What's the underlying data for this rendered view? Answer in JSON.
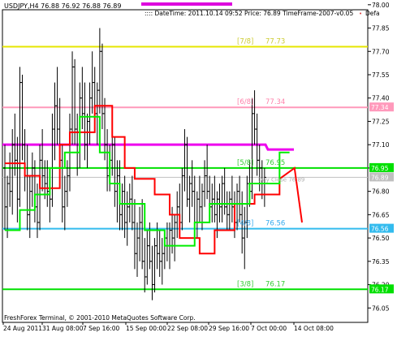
{
  "chart_data": {
    "type": "candlestick",
    "header": {
      "symbol_info": "USDJPY,H4  76.88 76.92 76.88 76.89",
      "info": ":::: DateTime: 2011.10.14 09:52    Price: 76.89    TimeFrame-2007-v0.05",
      "extra": "Defa"
    },
    "footer": "FreshForex Terminal, © 2001-2010 MetaQuotes Software Corp.",
    "ylim": [
      76.02,
      78.02
    ],
    "y_ticks": [
      "78.00",
      "77.85",
      "77.70",
      "77.55",
      "77.40",
      "77.25",
      "77.10",
      "76.95",
      "76.80",
      "76.65",
      "76.50",
      "76.35",
      "76.20",
      "76.05"
    ],
    "x_ticks": [
      "24 Aug 2011",
      "31 Aug 08:00",
      "7 Sep 16:00",
      "15 Sep 00:00",
      "22 Sep 08:00",
      "29 Sep 16:00",
      "7 Oct 00:00",
      "14 Oct 08:00"
    ],
    "bar_count": 120,
    "levels": [
      {
        "name": "[7/8]",
        "value_label": "77.73",
        "price": 77.73,
        "color": "#e6e600",
        "label_color": "#cccc33",
        "tag": ""
      },
      {
        "name": "[6/8]",
        "value_label": "77.34",
        "price": 77.34,
        "color": "#ff99bb",
        "label_color": "#ff80aa",
        "tag": "77.34"
      },
      {
        "name": "[5/8]",
        "value_label": "76.95",
        "price": 76.95,
        "color": "#00e000",
        "label_color": "#33cc33",
        "tag": "76.95"
      },
      {
        "name": "[4/8]",
        "value_label": "76.56",
        "price": 76.56,
        "color": "#33bbee",
        "label_color": "#33aaee",
        "tag": "76.56"
      },
      {
        "name": "[3/8]",
        "value_label": "76.17",
        "price": 76.17,
        "color": "#00e000",
        "label_color": "#33cc33",
        "tag": "76.17"
      }
    ],
    "current_price": {
      "value": 76.89,
      "tag": "76.89"
    },
    "magenta_line": {
      "price": 77.1,
      "color": "#ee00ee"
    },
    "daily_label": "Day Close 76.89",
    "colors": {
      "bars": "#000000",
      "red_line": "#ff0000",
      "green_line": "#00ee00",
      "grey": "#c0c0c0"
    },
    "bars": [
      [
        76.95,
        77.1,
        76.55,
        76.7
      ],
      [
        76.7,
        76.9,
        76.5,
        76.85
      ],
      [
        76.85,
        77.05,
        76.7,
        76.8
      ],
      [
        76.8,
        77.2,
        76.65,
        77.1
      ],
      [
        77.1,
        77.3,
        76.9,
        77.0
      ],
      [
        77.0,
        77.15,
        76.6,
        76.75
      ],
      [
        76.75,
        77.6,
        76.7,
        77.5
      ],
      [
        77.5,
        77.55,
        77.0,
        77.1
      ],
      [
        77.1,
        77.2,
        76.8,
        76.9
      ],
      [
        76.9,
        77.1,
        76.55,
        76.65
      ],
      [
        76.65,
        76.9,
        76.5,
        76.8
      ],
      [
        76.8,
        77.05,
        76.7,
        76.95
      ],
      [
        76.95,
        77.0,
        76.6,
        76.7
      ],
      [
        76.7,
        76.85,
        76.5,
        76.6
      ],
      [
        76.6,
        77.1,
        76.55,
        77.0
      ],
      [
        77.0,
        77.2,
        76.8,
        76.9
      ],
      [
        76.9,
        77.0,
        76.75,
        76.85
      ],
      [
        76.85,
        77.0,
        76.7,
        76.8
      ],
      [
        76.8,
        76.9,
        76.6,
        76.75
      ],
      [
        76.75,
        77.3,
        76.7,
        77.2
      ],
      [
        77.2,
        77.5,
        77.0,
        77.35
      ],
      [
        77.35,
        77.6,
        77.1,
        77.2
      ],
      [
        77.2,
        77.4,
        76.9,
        77.0
      ],
      [
        77.0,
        77.1,
        76.6,
        76.7
      ],
      [
        76.7,
        76.9,
        76.55,
        76.8
      ],
      [
        76.8,
        77.0,
        76.7,
        76.9
      ],
      [
        76.9,
        77.3,
        76.8,
        77.2
      ],
      [
        77.2,
        77.7,
        77.1,
        77.6
      ],
      [
        77.6,
        77.65,
        77.1,
        77.2
      ],
      [
        77.2,
        77.3,
        76.9,
        77.05
      ],
      [
        77.05,
        77.5,
        76.95,
        77.4
      ],
      [
        77.4,
        77.6,
        77.2,
        77.3
      ],
      [
        77.3,
        77.5,
        77.0,
        77.1
      ],
      [
        77.1,
        77.3,
        76.95,
        77.25
      ],
      [
        77.25,
        77.5,
        77.1,
        77.4
      ],
      [
        77.4,
        77.7,
        77.3,
        77.5
      ],
      [
        77.5,
        77.6,
        77.2,
        77.3
      ],
      [
        77.3,
        77.5,
        77.1,
        77.45
      ],
      [
        77.45,
        77.85,
        77.3,
        77.7
      ],
      [
        77.7,
        77.75,
        77.2,
        77.3
      ],
      [
        77.3,
        77.4,
        77.0,
        77.1
      ],
      [
        77.1,
        77.2,
        76.8,
        76.9
      ],
      [
        76.9,
        77.1,
        76.8,
        77.0
      ],
      [
        77.0,
        77.2,
        76.9,
        77.1
      ],
      [
        77.1,
        77.15,
        76.7,
        76.8
      ],
      [
        76.8,
        77.0,
        76.6,
        76.9
      ],
      [
        76.9,
        77.0,
        76.55,
        76.65
      ],
      [
        76.65,
        76.85,
        76.55,
        76.8
      ],
      [
        76.8,
        76.9,
        76.5,
        76.6
      ],
      [
        76.6,
        76.8,
        76.45,
        76.7
      ],
      [
        76.7,
        76.85,
        76.6,
        76.75
      ],
      [
        76.75,
        76.9,
        76.55,
        76.6
      ],
      [
        76.6,
        76.75,
        76.3,
        76.4
      ],
      [
        76.4,
        76.6,
        76.25,
        76.5
      ],
      [
        76.5,
        76.7,
        76.35,
        76.6
      ],
      [
        76.6,
        76.75,
        76.3,
        76.35
      ],
      [
        76.35,
        76.5,
        76.15,
        76.25
      ],
      [
        76.25,
        76.55,
        76.2,
        76.45
      ],
      [
        76.45,
        76.6,
        76.3,
        76.35
      ],
      [
        76.35,
        76.45,
        76.1,
        76.2
      ],
      [
        76.2,
        76.5,
        76.15,
        76.45
      ],
      [
        76.45,
        76.6,
        76.3,
        76.4
      ],
      [
        76.4,
        76.55,
        76.25,
        76.35
      ],
      [
        76.35,
        76.5,
        76.2,
        76.4
      ],
      [
        76.4,
        76.55,
        76.3,
        76.5
      ],
      [
        76.5,
        76.6,
        76.35,
        76.45
      ],
      [
        76.45,
        76.6,
        76.3,
        76.55
      ],
      [
        76.55,
        76.7,
        76.4,
        76.5
      ],
      [
        76.5,
        76.65,
        76.35,
        76.6
      ],
      [
        76.6,
        76.8,
        76.5,
        76.7
      ],
      [
        76.7,
        76.85,
        76.55,
        76.6
      ],
      [
        76.6,
        76.95,
        76.55,
        76.9
      ],
      [
        76.9,
        77.2,
        76.8,
        77.1
      ],
      [
        77.1,
        77.15,
        76.7,
        76.75
      ],
      [
        76.75,
        76.9,
        76.6,
        76.85
      ],
      [
        76.85,
        77.0,
        76.7,
        76.8
      ],
      [
        76.8,
        76.9,
        76.55,
        76.6
      ],
      [
        76.6,
        76.8,
        76.5,
        76.75
      ],
      [
        76.75,
        76.9,
        76.6,
        76.7
      ],
      [
        76.7,
        76.85,
        76.55,
        76.8
      ],
      [
        76.8,
        77.0,
        76.7,
        76.9
      ],
      [
        76.9,
        77.1,
        76.75,
        76.8
      ],
      [
        76.8,
        76.9,
        76.6,
        76.7
      ],
      [
        76.7,
        76.85,
        76.6,
        76.75
      ],
      [
        76.75,
        76.9,
        76.6,
        76.65
      ],
      [
        76.65,
        76.8,
        76.5,
        76.75
      ],
      [
        76.75,
        76.85,
        76.6,
        76.7
      ],
      [
        76.7,
        76.9,
        76.6,
        76.85
      ],
      [
        76.85,
        76.95,
        76.65,
        76.7
      ],
      [
        76.7,
        76.8,
        76.55,
        76.65
      ],
      [
        76.65,
        76.8,
        76.55,
        76.75
      ],
      [
        76.75,
        76.9,
        76.6,
        76.7
      ],
      [
        76.7,
        76.8,
        76.5,
        76.6
      ],
      [
        76.6,
        76.85,
        76.55,
        76.8
      ],
      [
        76.8,
        76.9,
        76.6,
        76.65
      ],
      [
        76.65,
        76.8,
        76.4,
        76.5
      ],
      [
        76.5,
        76.7,
        76.3,
        76.6
      ],
      [
        76.6,
        76.9,
        76.5,
        76.85
      ],
      [
        76.85,
        77.0,
        76.7,
        76.8
      ],
      [
        76.8,
        77.4,
        76.75,
        77.3
      ],
      [
        77.3,
        77.45,
        77.1,
        77.2
      ],
      [
        77.2,
        77.3,
        76.9,
        77.0
      ],
      [
        77.0,
        77.1,
        76.8,
        76.95
      ],
      [
        76.95,
        77.0,
        76.75,
        76.85
      ],
      [
        76.85,
        76.95,
        76.7,
        76.89
      ]
    ],
    "red_line": [
      [
        0,
        76.98
      ],
      [
        8,
        76.98
      ],
      [
        8,
        76.9
      ],
      [
        14,
        76.9
      ],
      [
        14,
        76.82
      ],
      [
        22,
        76.82
      ],
      [
        22,
        77.1
      ],
      [
        26,
        77.1
      ],
      [
        26,
        77.18
      ],
      [
        36,
        77.18
      ],
      [
        36,
        77.35
      ],
      [
        43,
        77.35
      ],
      [
        43,
        77.15
      ],
      [
        48,
        77.15
      ],
      [
        48,
        76.95
      ],
      [
        52,
        76.95
      ],
      [
        52,
        76.88
      ],
      [
        60,
        76.88
      ],
      [
        60,
        76.78
      ],
      [
        66,
        76.78
      ],
      [
        66,
        76.65
      ],
      [
        70,
        76.65
      ],
      [
        70,
        76.5
      ],
      [
        78,
        76.5
      ],
      [
        78,
        76.4
      ],
      [
        84,
        76.4
      ],
      [
        84,
        76.55
      ],
      [
        92,
        76.55
      ],
      [
        92,
        76.72
      ],
      [
        100,
        76.72
      ],
      [
        100,
        76.78
      ],
      [
        110,
        76.78
      ],
      [
        110,
        76.88
      ],
      [
        116,
        76.95
      ],
      [
        119,
        76.6
      ]
    ],
    "green_line": [
      [
        0,
        76.55
      ],
      [
        6,
        76.55
      ],
      [
        6,
        76.68
      ],
      [
        12,
        76.68
      ],
      [
        12,
        76.78
      ],
      [
        18,
        76.78
      ],
      [
        18,
        76.95
      ],
      [
        24,
        76.95
      ],
      [
        24,
        77.05
      ],
      [
        30,
        77.05
      ],
      [
        30,
        77.28
      ],
      [
        38,
        77.28
      ],
      [
        38,
        77.05
      ],
      [
        42,
        77.05
      ],
      [
        42,
        76.85
      ],
      [
        46,
        76.85
      ],
      [
        46,
        76.72
      ],
      [
        56,
        76.72
      ],
      [
        56,
        76.55
      ],
      [
        64,
        76.55
      ],
      [
        64,
        76.45
      ],
      [
        76,
        76.45
      ],
      [
        76,
        76.6
      ],
      [
        82,
        76.6
      ],
      [
        82,
        76.72
      ],
      [
        98,
        76.72
      ],
      [
        98,
        76.85
      ],
      [
        110,
        76.85
      ],
      [
        110,
        77.05
      ],
      [
        114,
        77.05
      ]
    ]
  }
}
